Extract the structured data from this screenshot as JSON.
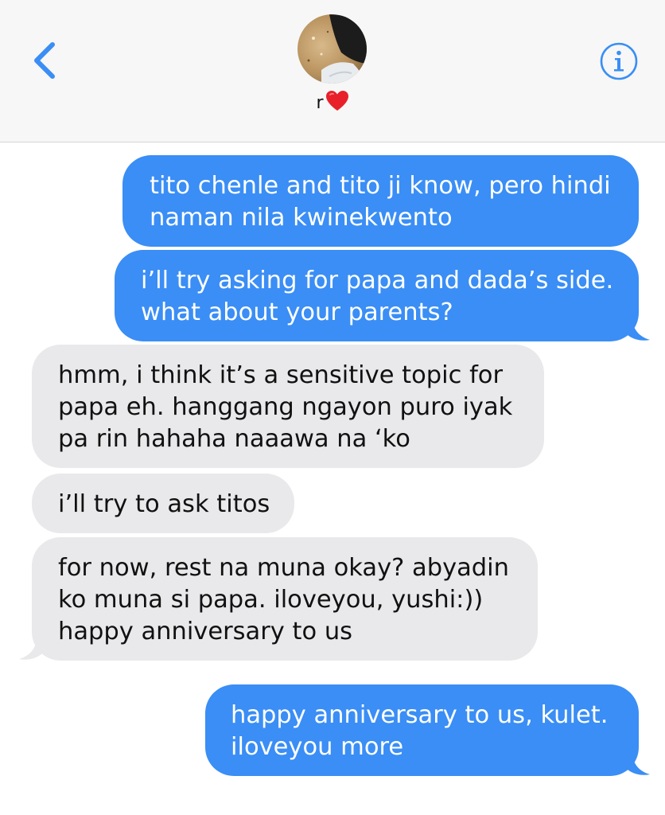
{
  "header": {
    "back_icon": "chevron-left-icon",
    "contact_name": "r",
    "contact_emoji": "red-heart",
    "info_icon": "info-circle-icon",
    "accent_color": "#3a8ef5"
  },
  "messages": [
    {
      "direction": "sent",
      "text": "tito chenle and tito ji know, pero hindi\nnaman nila kwinekwento"
    },
    {
      "direction": "sent",
      "text": "i’ll try asking for papa and dada’s side.\nwhat about your parents?"
    },
    {
      "direction": "received",
      "text": "hmm, i think it’s a sensitive topic for\npapa eh. hanggang ngayon puro iyak\npa rin hahaha naaawa na ‘ko"
    },
    {
      "direction": "received",
      "text": "i’ll try to ask titos"
    },
    {
      "direction": "received",
      "text": "for now, rest na muna okay? abyadin\nko muna si papa. iloveyou, yushi:))\nhappy anniversary to us"
    },
    {
      "direction": "sent",
      "text": "happy anniversary to us, kulet.\niloveyou more"
    }
  ],
  "colors": {
    "sent_bubble": "#3a8ef5",
    "received_bubble": "#e9e9eb",
    "header_bg": "#f7f7f7"
  }
}
